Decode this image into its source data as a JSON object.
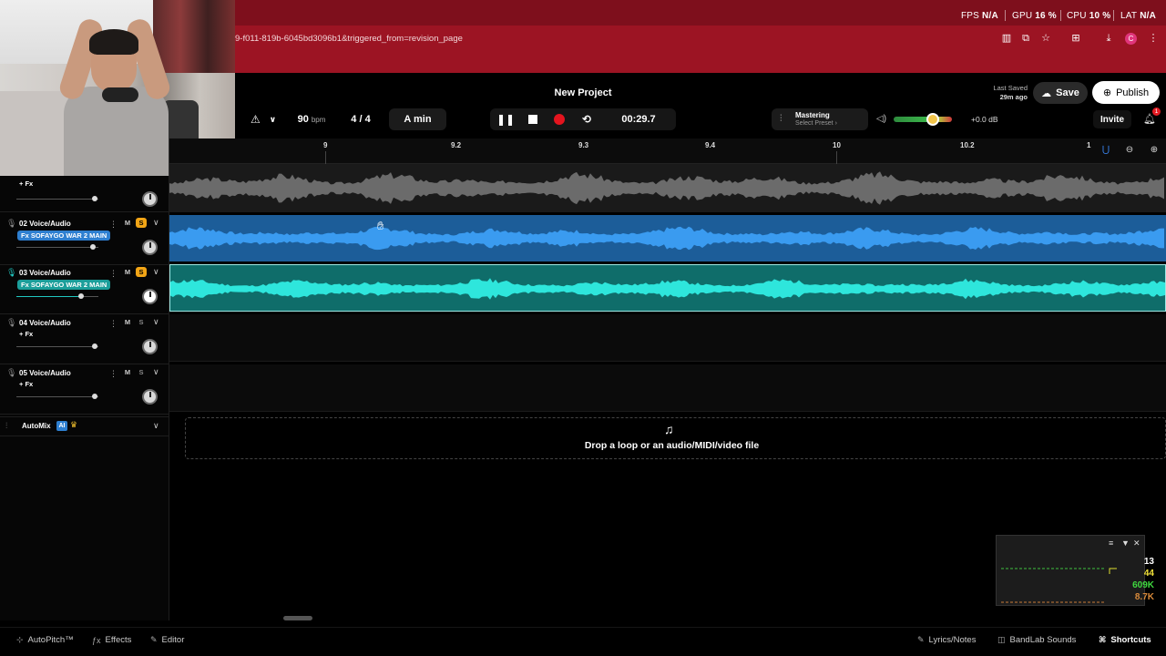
{
  "browser": {
    "perf": {
      "fps_label": "FPS",
      "fps_value": "N/A",
      "gpu_label": "GPU",
      "gpu_value": "16 %",
      "cpu_label": "CPU",
      "cpu_value": "10 %",
      "lat_label": "LAT",
      "lat_value": "N/A"
    },
    "url_text": "9-f011-819b-6045bd3096b1&triggered_from=revision_page",
    "profile_initial": "C"
  },
  "header": {
    "project_title": "New Project",
    "last_saved_label": "Last Saved",
    "last_saved_time": "29m ago",
    "save_label": "Save",
    "publish_label": "Publish",
    "invite_label": "Invite",
    "notification_count": "1"
  },
  "transport": {
    "tempo": "90",
    "tempo_unit": "bpm",
    "time_signature": "4 / 4",
    "key": "A min",
    "time": "00:29.7",
    "mastering_label": "Mastering",
    "mastering_preset": "Select Preset",
    "master_gain": "+0.0 dB",
    "master_volume_fraction": 0.67
  },
  "ruler": {
    "ticks": [
      "9",
      "9.2",
      "9.3",
      "9.4",
      "10",
      "10.2",
      "1"
    ]
  },
  "tracks": [
    {
      "name": "",
      "fx": "+ Fx",
      "solo": false,
      "fader": 0.95
    },
    {
      "name": "02 Voice/Audio",
      "fx": "Fx SOFAYGO WAR 2 MAIN",
      "solo": true,
      "fader": 0.93
    },
    {
      "name": "03 Voice/Audio",
      "fx": "Fx SOFAYGO WAR 2 MAIN",
      "solo": true,
      "fader": 0.8
    },
    {
      "name": "04 Voice/Audio",
      "fx": "+ Fx",
      "solo": false,
      "fader": 0.95
    },
    {
      "name": "05 Voice/Audio",
      "fx": "+ Fx",
      "solo": false,
      "fader": 0.95
    }
  ],
  "track_buttons": {
    "mute": "M",
    "solo": "S"
  },
  "automix": {
    "label": "AutoMix",
    "badge": "AI"
  },
  "dropzone": {
    "text": "Drop a loop or an audio/MIDI/video file"
  },
  "overlay": {
    "v1": "13",
    "v2": "44",
    "v3": "609K",
    "v4": "8.7K"
  },
  "footer": {
    "autopitch": "AutoPitch™",
    "effects": "Effects",
    "editor": "Editor",
    "lyrics": "Lyrics/Notes",
    "sounds": "BandLab Sounds",
    "shortcuts": "Shortcuts"
  },
  "colors": {
    "browser_red": "#9c1423",
    "track2_blue": "#1c5d99",
    "track3_teal": "#0f6d6a",
    "record": "#e4141e",
    "solo": "#f2a516"
  }
}
